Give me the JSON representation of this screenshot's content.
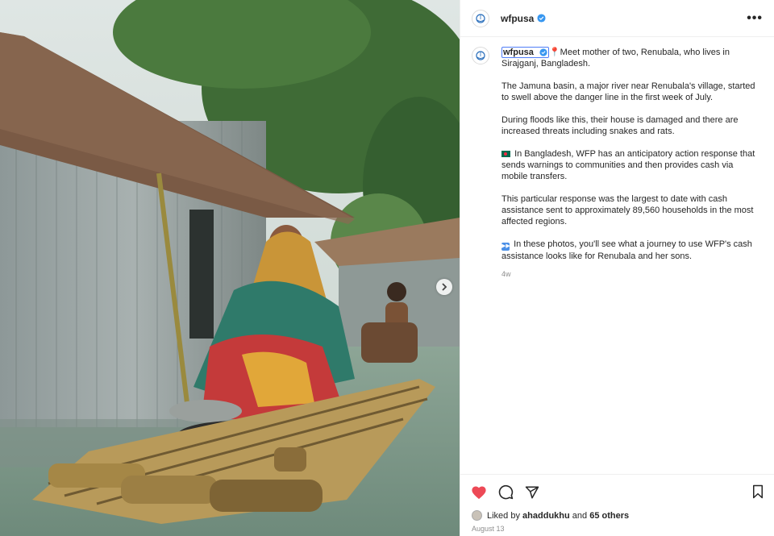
{
  "post": {
    "username": "wfpusa",
    "more_icon": "more-options-icon"
  },
  "caption": {
    "username": "wfpusa",
    "line1": "Meet mother of two, Renubala, who lives in Sirajganj, Bangladesh.",
    "para2": "The Jamuna basin, a major river near Renubala's village, started to swell above the danger line in the first week of July.",
    "para3": "During floods like this, their house is damaged and there are increased threats including snakes and rats.",
    "para4": "In Bangladesh, WFP has an anticipatory action response that sends warnings to communities and then provides cash via mobile transfers.",
    "para5": "This particular response was the largest to date with cash assistance sent to approximately 89,560 households in the most affected regions.",
    "para6": "In these photos, you'll see what a journey to use WFP's cash assistance looks like for Renubala and her sons.",
    "time_ago": "4w"
  },
  "likes": {
    "prefix": "Liked by",
    "user": "ahaddukhu",
    "joiner": "and",
    "others": "65 others"
  },
  "date": "August 13",
  "colors": {
    "like": "#ed4956",
    "verified": "#3897f0",
    "link_outline": "#4f7df7"
  }
}
